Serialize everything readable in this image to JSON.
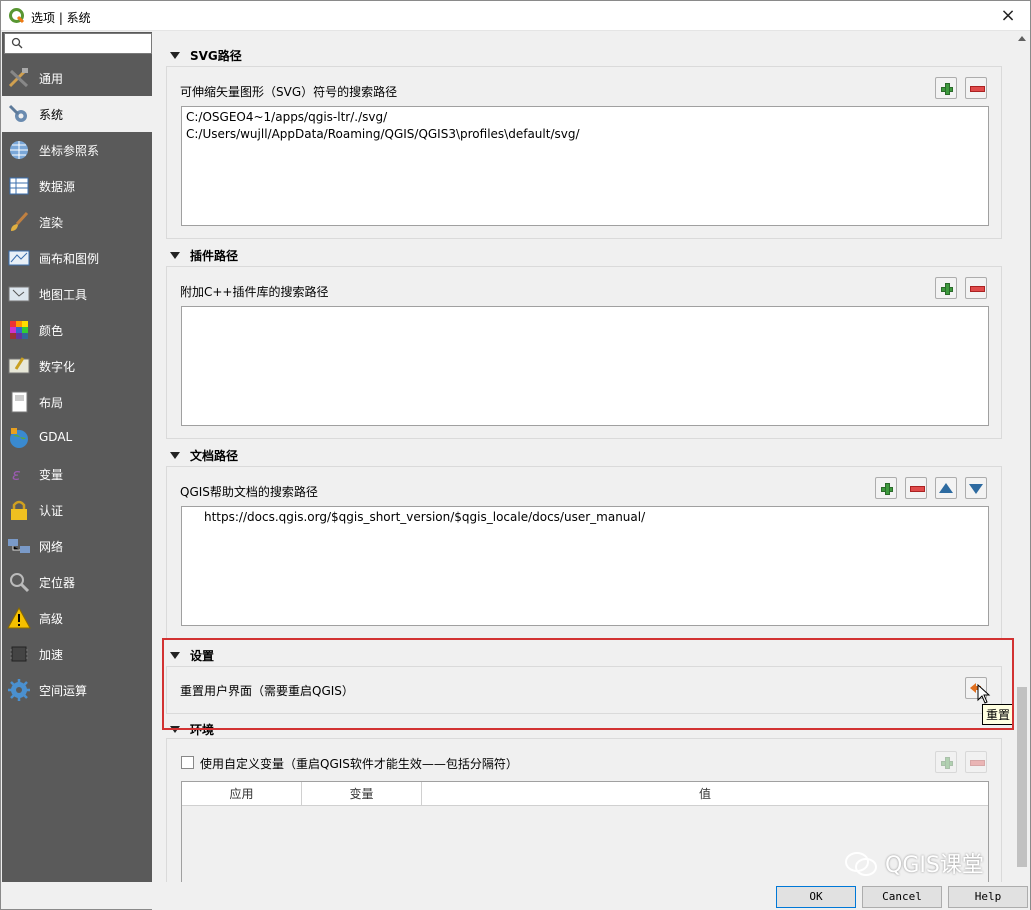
{
  "window": {
    "title": "选项 | 系统",
    "close": "×"
  },
  "sidebar": {
    "search_placeholder": "",
    "items": [
      {
        "label": "通用",
        "icon": "tools-icon"
      },
      {
        "label": "系统",
        "icon": "wrench-gear-icon",
        "active": true
      },
      {
        "label": "坐标参照系",
        "icon": "globe-grid-icon"
      },
      {
        "label": "数据源",
        "icon": "table-icon"
      },
      {
        "label": "渲染",
        "icon": "paintbrush-icon"
      },
      {
        "label": "画布和图例",
        "icon": "map-canvas-icon"
      },
      {
        "label": "地图工具",
        "icon": "map-tools-icon"
      },
      {
        "label": "颜色",
        "icon": "color-palette-icon"
      },
      {
        "label": "数字化",
        "icon": "digitize-icon"
      },
      {
        "label": "布局",
        "icon": "layout-icon"
      },
      {
        "label": "GDAL",
        "icon": "gdal-globe-icon"
      },
      {
        "label": "变量",
        "icon": "variable-icon"
      },
      {
        "label": "认证",
        "icon": "lock-icon"
      },
      {
        "label": "网络",
        "icon": "network-icon"
      },
      {
        "label": "定位器",
        "icon": "magnifier-icon"
      },
      {
        "label": "高级",
        "icon": "warning-icon"
      },
      {
        "label": "加速",
        "icon": "chip-icon"
      },
      {
        "label": "空间运算",
        "icon": "gear-icon"
      }
    ]
  },
  "sections": {
    "svg": {
      "title": "SVG路径",
      "label": "可伸缩矢量图形（SVG）符号的搜索路径",
      "paths": [
        "C:/OSGEO4~1/apps/qgis-ltr/./svg/",
        "C:/Users/wujll/AppData/Roaming/QGIS/QGIS3\\profiles\\default/svg/"
      ]
    },
    "plugin": {
      "title": "插件路径",
      "label": "附加C++插件库的搜索路径"
    },
    "docs": {
      "title": "文档路径",
      "label": "QGIS帮助文档的搜索路径",
      "paths": [
        "https://docs.qgis.org/$qgis_short_version/$qgis_locale/docs/user_manual/"
      ]
    },
    "settings": {
      "title": "设置",
      "label": "重置用户界面（需要重启QGIS）",
      "tooltip": "重置"
    },
    "env": {
      "title": "环境",
      "checkbox_label": "使用自定义变量（重启QGIS软件才能生效——包括分隔符）",
      "columns": [
        "应用",
        "变量",
        "值"
      ]
    }
  },
  "buttons": {
    "ok": "OK",
    "cancel": "Cancel",
    "help": "Help"
  },
  "watermark": "QGIS课堂"
}
